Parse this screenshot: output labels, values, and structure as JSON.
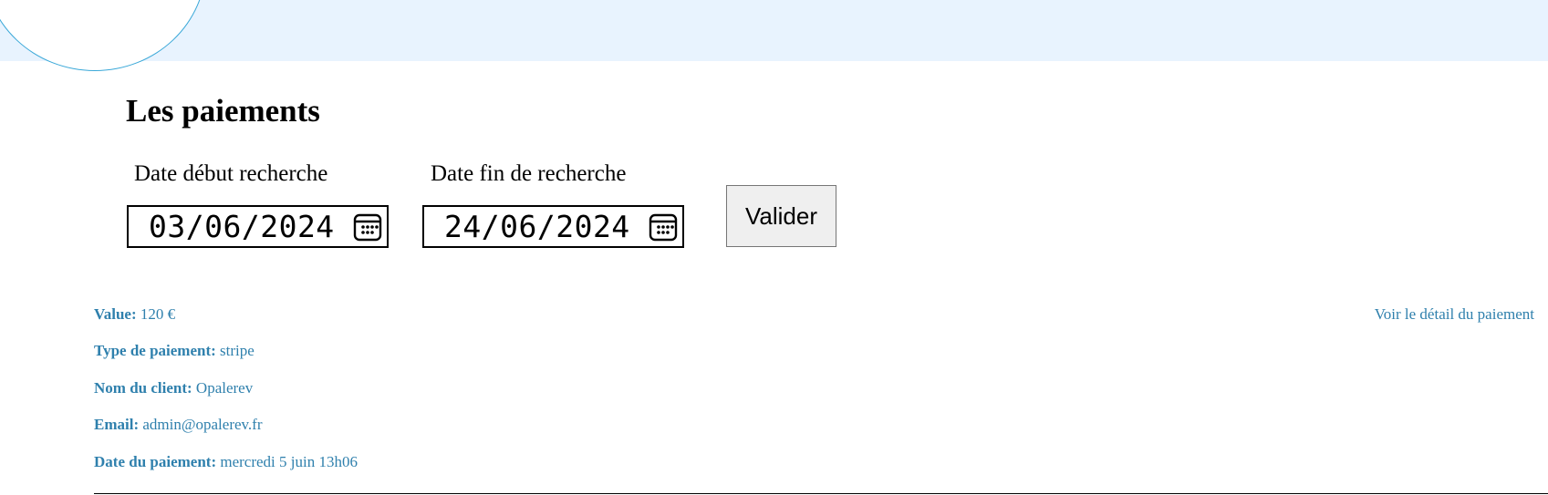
{
  "header": {
    "title": "Les paiements"
  },
  "search": {
    "start_label": "Date début recherche",
    "start_value": "03/06/2024",
    "end_label": "Date fin de recherche",
    "end_value": "24/06/2024",
    "submit_label": "Valider"
  },
  "payment": {
    "value_label": "Value:",
    "value": "120 €",
    "type_label": "Type de paiement:",
    "type": "stripe",
    "client_label": "Nom du client:",
    "client": "Opalerev",
    "email_label": "Email:",
    "email": "admin@opalerev.fr",
    "date_label": "Date du paiement:",
    "date": "mercredi 5 juin 13h06",
    "detail_link": "Voir le détail du paiement"
  },
  "colors": {
    "banner": "#e8f3fe",
    "accent": "#2f80ad",
    "circle_stroke": "#3aa8d8"
  },
  "icons": {
    "date_picker": "calendar-icon"
  }
}
